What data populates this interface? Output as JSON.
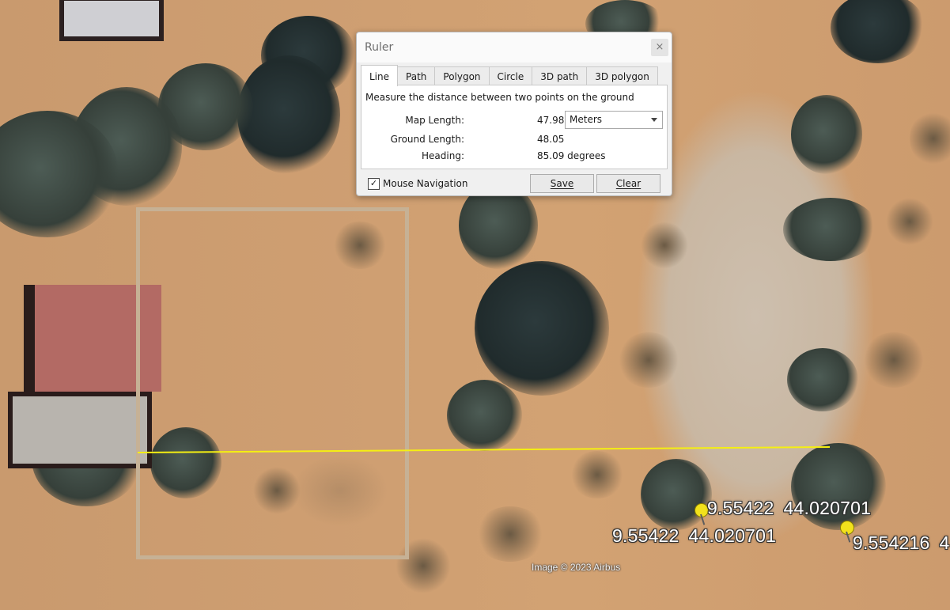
{
  "ruler": {
    "title": "Ruler",
    "close_glyph": "×",
    "tabs": [
      {
        "label": "Line",
        "active": true
      },
      {
        "label": "Path"
      },
      {
        "label": "Polygon"
      },
      {
        "label": "Circle"
      },
      {
        "label": "3D path"
      },
      {
        "label": "3D polygon"
      }
    ],
    "description": "Measure the distance between two points on the ground",
    "map_length": {
      "label": "Map Length:",
      "value": "47.98"
    },
    "unit": {
      "selected": "Meters"
    },
    "ground_length": {
      "label": "Ground Length:",
      "value": "48.05"
    },
    "heading": {
      "label": "Heading:",
      "value": "85.09 degrees"
    },
    "mouse_navigation": {
      "label": "Mouse Navigation",
      "checked": true,
      "check_glyph": "✓"
    },
    "buttons": {
      "save": "Save",
      "clear": "Clear"
    }
  },
  "map": {
    "measurement_line_color": "#f5ef12",
    "placemarks": [
      {
        "lat": "9.55422",
        "lon": "44.020701",
        "icon": "yellow-pushpin-icon"
      },
      {
        "lat": "9.55422",
        "lon": "44.020701",
        "icon": "yellow-pushpin-icon"
      },
      {
        "lat": "9.554216",
        "lon": "4",
        "icon": "yellow-pushpin-icon"
      }
    ],
    "attribution": "Image © 2023 Airbus"
  }
}
